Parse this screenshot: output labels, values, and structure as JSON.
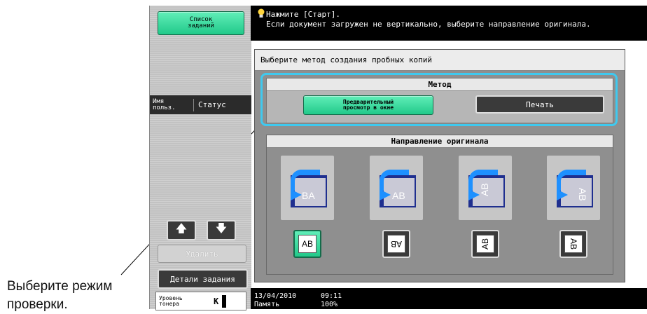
{
  "left_panel": {
    "job_list_button": "Список\nзаданий",
    "columns": {
      "user": "Имя\nпольз.",
      "status": "Статус"
    },
    "delete_button": "Удалить",
    "details_button": "Детали задания",
    "toner": {
      "label": "Уровень\nтонера",
      "color": "K"
    }
  },
  "message": {
    "line1": "Нажмите [Старт].",
    "line2": "Если документ загружен не вертикально, выберите направление оригинала."
  },
  "panel": {
    "title": "Выберите метод создания пробных копий",
    "method": {
      "header": "Метод",
      "preview_button": "Предварительный\nпросмотр в окне",
      "print_button": "Печать",
      "selected": "preview"
    },
    "orientation": {
      "header": "Направление оригинала",
      "buttons": [
        {
          "label": "AB",
          "selected": true
        },
        {
          "label": "AB",
          "selected": false
        },
        {
          "label": "AB",
          "selected": false
        },
        {
          "label": "AB",
          "selected": false
        }
      ]
    }
  },
  "status_bar": {
    "date": "13/04/2010",
    "time": "09:11",
    "memory_label": "Память",
    "memory_value": "100%"
  },
  "callout": "Выберите режим проверки.",
  "colors": {
    "accent_green": "#22c98a",
    "highlight_cyan": "#3fc9ef",
    "icon_blue": "#1e90ff"
  }
}
